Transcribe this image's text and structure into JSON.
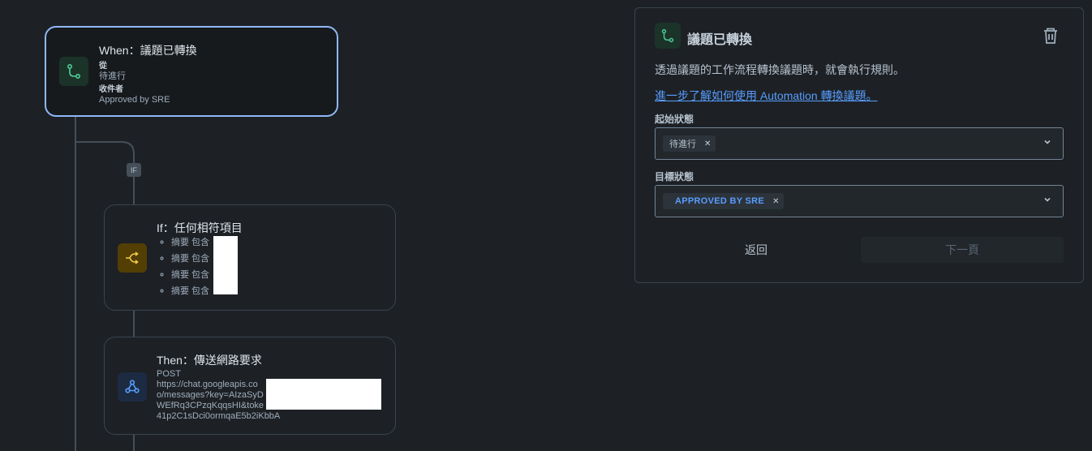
{
  "colors": {
    "accent": "#579dff",
    "selected_border": "#8fb8f6",
    "trigger_icon_bg": "#1c3329",
    "trigger_icon_fg": "#4bce97",
    "condition_icon_bg": "#533f04",
    "condition_icon_fg": "#f5cd47",
    "action_icon_bg": "#1c2b41",
    "action_icon_fg": "#579dff"
  },
  "flow": {
    "trigger": {
      "title": "When：議題已轉換",
      "from_label": "從",
      "from_value": "待進行",
      "to_label": "收件者",
      "to_value": "Approved by SRE",
      "icon": "status-transition-icon"
    },
    "if_badge": "IF",
    "condition": {
      "title": "If：任何相符項目",
      "icon": "branch-icon",
      "items": [
        "摘要 包含",
        "摘要 包含",
        "摘要 包含",
        "摘要 包含"
      ]
    },
    "action": {
      "title": "Then：傳送網路要求",
      "icon": "webhook-icon",
      "lines": [
        "POST",
        "https://chat.googleapis.co",
        "o/messages?key=AIzaSyD",
        "WEfRq3CPzqKqqsHI&toke",
        "41p2C1sDci0ormqaE5b2iKbbA"
      ]
    }
  },
  "panel": {
    "title": "議題已轉換",
    "description": "透過議題的工作流程轉換議題時，就會執行規則。",
    "learn_more": "進一步了解如何使用 Automation 轉換議題。",
    "from_label": "起始狀態",
    "from_chip": "待進行",
    "to_label": "目標狀態",
    "to_chip": "APPROVED BY SRE",
    "remove_glyph": "✕",
    "back_button": "返回",
    "next_button": "下一頁"
  }
}
